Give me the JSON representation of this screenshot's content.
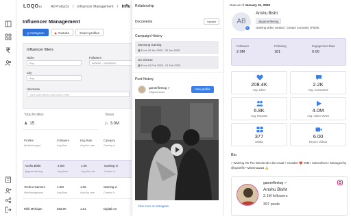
{
  "rail": {
    "icons": [
      "pages-icon",
      "grid-icon",
      "rupee-icon",
      "users-icon",
      "reports-icon",
      "users-add-icon",
      "share-icon",
      "logout-icon"
    ]
  },
  "bg": {
    "logo": "LOQO",
    "logo_suffix": "ai",
    "breadcrumb": [
      "All Products",
      "/",
      "Influencer Management",
      "/",
      "Influ"
    ],
    "title": "Influencer Management",
    "tabs": [
      "Instagram",
      "Youtube",
      "Select profiles"
    ],
    "filters": {
      "title": "Influencer filters",
      "niche_label": "Niche",
      "niche_value": "Any",
      "followers_label": "Followers",
      "followers_value": "600000 - 15000000",
      "city_label": "City",
      "city_value": "Any",
      "username_label": "Username",
      "username_placeholder": "Type usernames and press enter"
    },
    "totals": {
      "profiles_label": "Total Profiles",
      "profiles_value": "15",
      "views_label": "Views",
      "views_value": "3.0M"
    },
    "table": {
      "headers": [
        "Profiles",
        "Followers",
        "Eng Rate",
        "Category"
      ],
      "subheaders": [
        "@kirtichowgnt",
        "Avg likes",
        "Avg like rate",
        "Gaming vi"
      ],
      "rows": [
        {
          "name": "Anshu Bisht",
          "handle": "@gamerfleetog",
          "followers": "2.0M",
          "followers_sub": "Avg likes",
          "eng": "1.06",
          "eng_sub": "Avg like rate",
          "category": "Gaming vi",
          "category_sub": "Creator A"
        },
        {
          "name": "Techno Gamerz",
          "handle": "@technogamerz",
          "followers": "1.6M",
          "followers_sub": "Avg likes",
          "eng": "1.06",
          "eng_sub": "Avg like rate",
          "category": "Gaming vi",
          "category_sub": "Creator A"
        },
        {
          "name": "Ritik Mehajan",
          "handle": "",
          "followers": "883.9K",
          "followers_sub": "",
          "eng": "1.01",
          "eng_sub": "",
          "category": "Digital cre",
          "category_sub": ""
        }
      ]
    }
  },
  "drawer": {
    "title": "Relationship",
    "close": "×",
    "documents_label": "Documents",
    "upload_label": "Upload",
    "campaign_history_label": "Campaign History",
    "campaigns": [
      {
        "name": "Samsung Gaming",
        "dates": "From 15 Jan 2025 - 30 Jan 2025"
      },
      {
        "name": "Go Cheese",
        "dates": "From 01 Feb 2025 - 01 Feb 2025"
      }
    ],
    "post_history_label": "Post History",
    "post": {
      "username": "gamerfleetog",
      "audio": "Original audio",
      "view_profile": "View profile",
      "view_more": "View more on Instagram"
    }
  },
  "panel": {
    "as_of_label": "Data as of",
    "as_of_date": "January 31, 2025",
    "name": "Anshu Bisht",
    "avatar_initials": "AB",
    "handle": "@gamerfleetog",
    "categories": "Gaming video creator | Creator Accounts | Public",
    "kpis": [
      {
        "label": "Followers",
        "value": "2.0M"
      },
      {
        "label": "Following",
        "value": "181"
      },
      {
        "label": "Engagement Rate",
        "value": "0.00"
      }
    ],
    "stats": [
      {
        "icon": "heart-icon",
        "value": "208.4K",
        "label": "Avg. Likes"
      },
      {
        "icon": "comment-icon",
        "value": "2.2K",
        "label": "Avg. Comments"
      },
      {
        "icon": "reposts-icon",
        "value": "6.8K",
        "label": "Avg. Reposts"
      },
      {
        "icon": "play-icon",
        "value": "4.0M",
        "label": "Avg. Video Views"
      },
      {
        "icon": "grid-icon",
        "value": "377",
        "label": "Media"
      },
      {
        "icon": "video-icon",
        "value": "6.00",
        "label": "Recent Videos"
      }
    ],
    "bio_title": "Bio",
    "bio_text": "» Working On The Weekends Like Usual • Youtuber ❤️ 15M+ Subscribers • Managed by @spiceiffx • Mainmuaaza 🙏",
    "instagram": {
      "handle": "gamerfleetog",
      "name": "Anshu Bisht",
      "followers": "2.1M followers",
      "posts": "397 posts"
    },
    "accent": "#3a80ea"
  }
}
